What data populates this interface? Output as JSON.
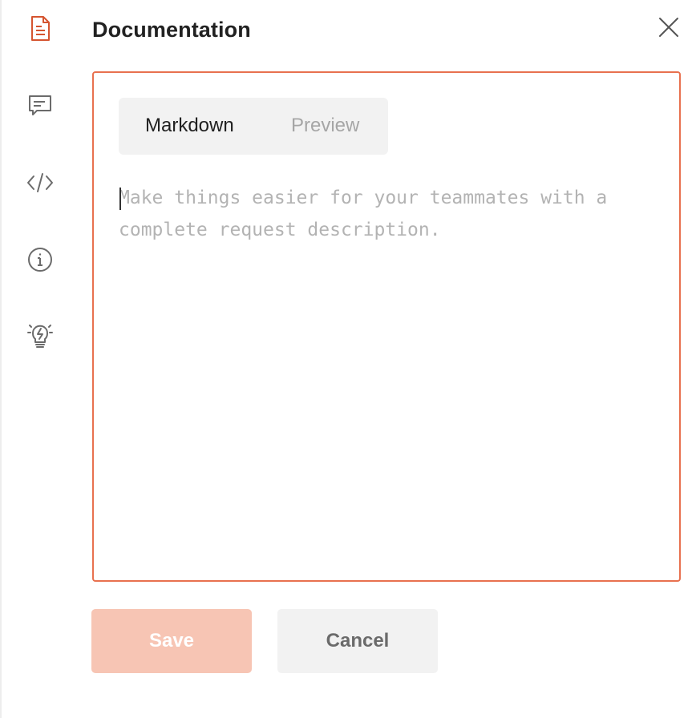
{
  "panel": {
    "title": "Documentation"
  },
  "sidebar": {
    "items": [
      {
        "icon": "document-icon",
        "active": true
      },
      {
        "icon": "comment-icon",
        "active": false
      },
      {
        "icon": "code-icon",
        "active": false
      },
      {
        "icon": "info-icon",
        "active": false
      },
      {
        "icon": "lightbulb-icon",
        "active": false
      }
    ]
  },
  "editor": {
    "tabs": [
      "Markdown",
      "Preview"
    ],
    "active_tab": "Markdown",
    "value": "",
    "placeholder": "Make things easier for your teammates with a complete request description."
  },
  "actions": {
    "save_label": "Save",
    "cancel_label": "Cancel"
  },
  "colors": {
    "accent": "#e8714f",
    "save_disabled_bg": "#f7c5b4",
    "neutral_bg": "#f2f2f2",
    "icon_gray": "#6b6b6b"
  }
}
